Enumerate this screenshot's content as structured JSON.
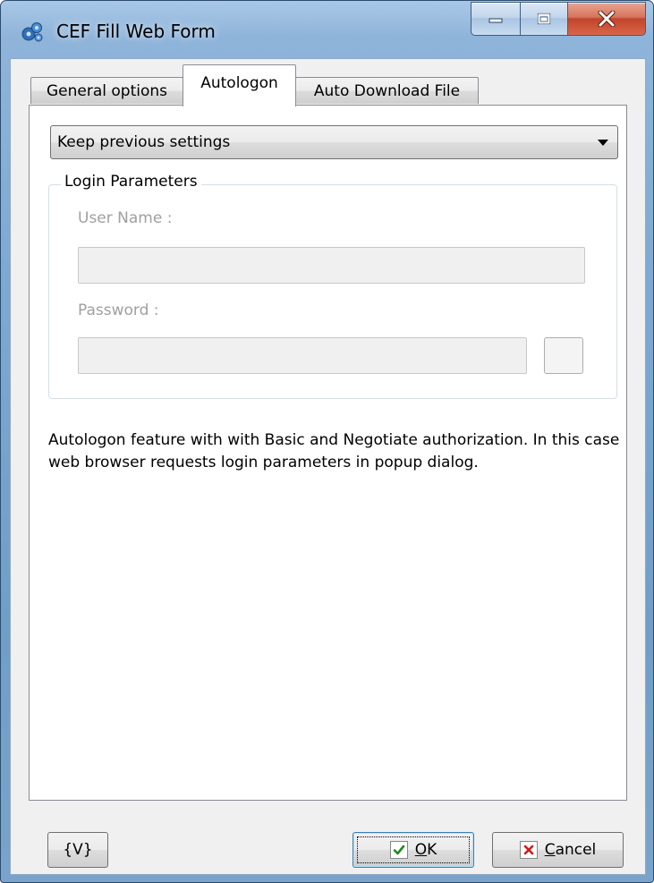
{
  "window": {
    "title": "CEF Fill Web Form"
  },
  "tabs": [
    {
      "label": "General options",
      "active": false
    },
    {
      "label": "Autologon",
      "active": true
    },
    {
      "label": "Auto Download File",
      "active": false
    }
  ],
  "autologon": {
    "mode_selected": "Keep previous settings",
    "group_title": "Login Parameters",
    "user_name_label": "User Name :",
    "user_name_value": "",
    "password_label": "Password :",
    "password_value": "",
    "description": "Autologon feature with with Basic and Negotiate authorization. In this case web browser requests login parameters in popup dialog."
  },
  "buttons": {
    "variables_label": "{V}",
    "ok_label_rest": "K",
    "ok_label_accel": "O",
    "cancel_label_accel": "C",
    "cancel_label_rest": "ancel"
  },
  "colors": {
    "ok_check": "#1f8a1f",
    "cancel_x": "#d11a1a",
    "disabled_text": "#a0a0a0"
  }
}
